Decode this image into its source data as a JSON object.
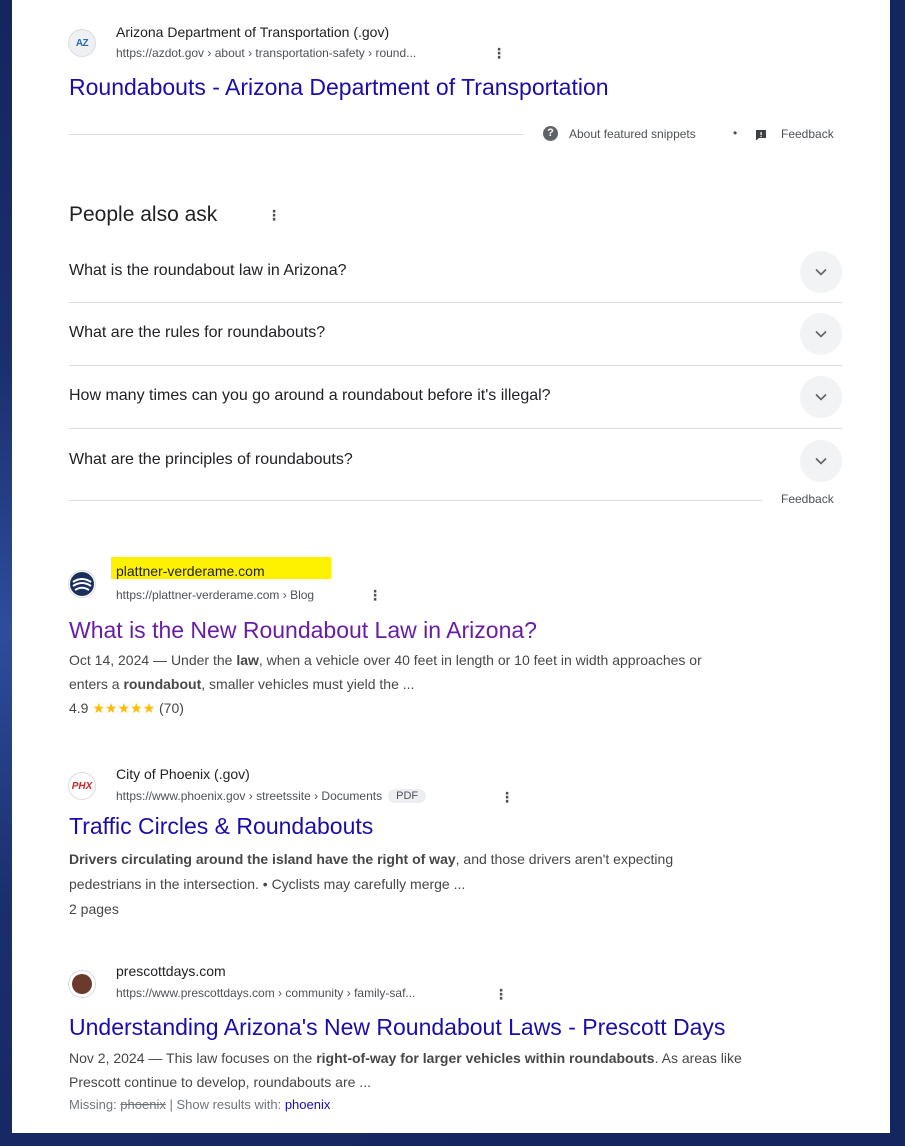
{
  "results": {
    "azdot": {
      "site_name": "Arizona Department of Transportation (.gov)",
      "cite": "https://azdot.gov › about › transportation-safety › round...",
      "title": "Roundabouts - Arizona Department of Transportation",
      "favicon_text": "AZ"
    },
    "plattner": {
      "site_name": "plattner-verderame.com",
      "cite": "https://plattner-verderame.com › Blog",
      "title": "What is the New Roundabout Law in Arizona?",
      "snippet_date": "Oct 14, 2024",
      "snippet_dash": " — Under the ",
      "snippet_b1": "law",
      "snippet_mid": ", when a vehicle over 40 feet in length or 10 feet in width approaches or",
      "snippet_line2a": "enters a ",
      "snippet_b2": "roundabout",
      "snippet_line2b": ", smaller vehicles must yield the ...",
      "rating": "4.9",
      "stars": "★★★★★",
      "reviews": "(70)",
      "highlight_color": "#fff200"
    },
    "phoenix": {
      "site_name": "City of Phoenix (.gov)",
      "cite": "https://www.phoenix.gov › streetssite › Documents",
      "badge": "PDF",
      "title": "Traffic Circles & Roundabouts",
      "snippet_b1": "Drivers circulating around the island have the right of way",
      "snippet_line1b": ", and those drivers aren't expecting",
      "snippet_line2": "pedestrians in the intersection. • Cyclists may carefully merge ...",
      "pages": "2 pages",
      "favicon_text": "PHX"
    },
    "prescott": {
      "site_name": "prescottdays.com",
      "cite": "https://www.prescottdays.com › community › family-saf...",
      "title": "Understanding Arizona's New Roundabout Laws - Prescott Days",
      "snippet_date": "Nov 2, 2024",
      "snippet_dash": " — This law focuses on the ",
      "snippet_b1": "right-of-way for larger vehicles within roundabouts",
      "snippet_line1b": ". As areas like",
      "snippet_line2": "Prescott continue to develop, roundabouts are ...",
      "missing_label": "Missing: ",
      "missing_term": "phoenix",
      "show_with": " | Show results with: ",
      "show_term": "phoenix"
    }
  },
  "featured_footer": {
    "about": "About featured snippets",
    "separator": "•",
    "feedback": "Feedback"
  },
  "paa": {
    "heading": "People also ask",
    "questions": [
      "What is the roundabout law in Arizona?",
      "What are the rules for roundabouts?",
      "How many times can you go around a roundabout before it's illegal?",
      "What are the principles of roundabouts?"
    ],
    "feedback": "Feedback"
  },
  "colors": {
    "link": "#1a0dab",
    "visited": "#681da8",
    "star": "#fbbc04",
    "background": "#1a2f6e"
  }
}
